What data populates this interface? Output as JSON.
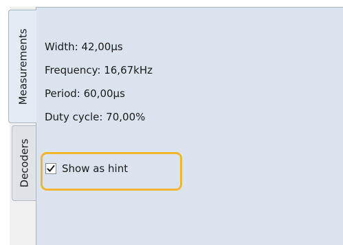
{
  "tabs": {
    "measurements_label": "Measurements",
    "decoders_label": "Decoders"
  },
  "measurements": {
    "width": "Width: 42,00µs",
    "frequency": "Frequency: 16,67kHz",
    "period": "Period: 60,00µs",
    "duty_cycle": "Duty cycle: 70,00%"
  },
  "options": {
    "show_as_hint_label": "Show as hint",
    "show_as_hint_checked": true
  },
  "icons": {
    "checkbox_checkmark": "checkmark-icon"
  },
  "colors": {
    "panel_background": "#dbe4ee",
    "highlight_outline": "#f2b52e"
  }
}
